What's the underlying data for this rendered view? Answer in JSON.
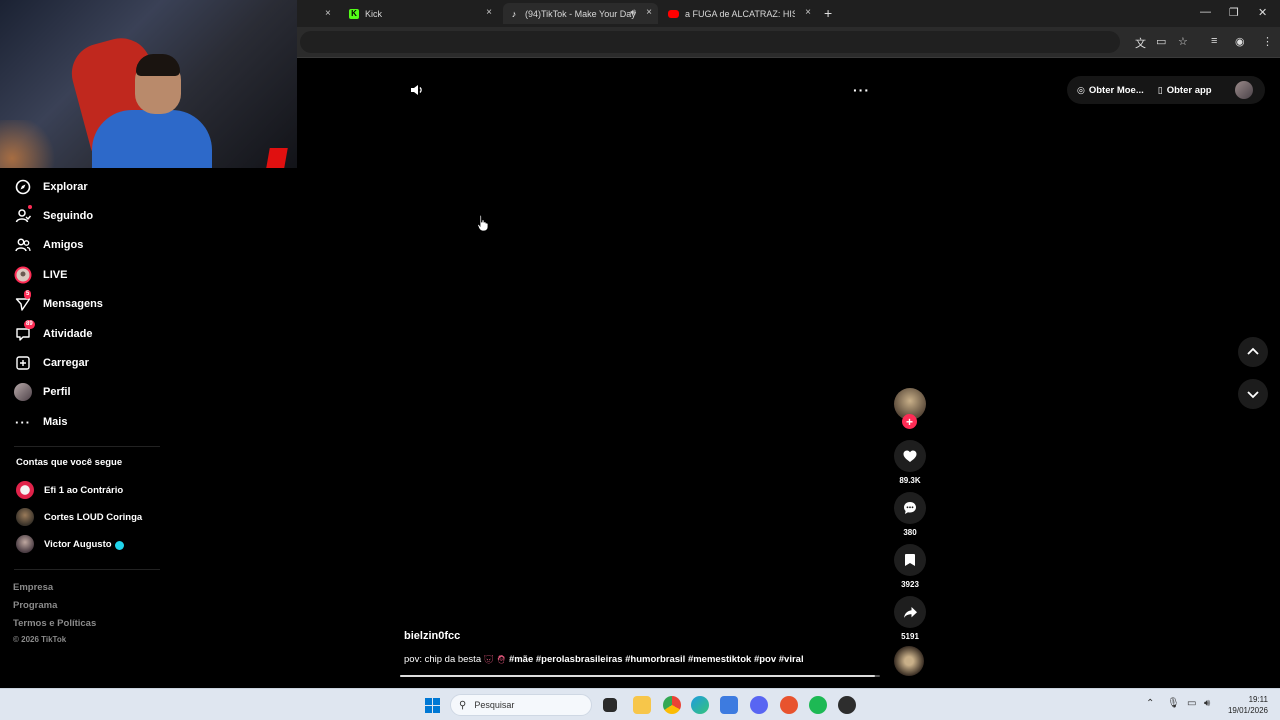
{
  "browser": {
    "tabs": [
      {
        "label": "Kick",
        "active": false
      },
      {
        "label": "(94)TikTok - Make Your Day",
        "active": true
      },
      {
        "label": "a FUGA de ALCATRAZ: HISTÓRI",
        "active": false
      }
    ],
    "add_tab": "+"
  },
  "sidebar": {
    "nav": [
      {
        "label": "Explorar",
        "icon": "compass-icon"
      },
      {
        "label": "Seguindo",
        "icon": "following-icon"
      },
      {
        "label": "Amigos",
        "icon": "friends-icon"
      },
      {
        "label": "LIVE",
        "icon": "live-icon"
      },
      {
        "label": "Mensagens",
        "icon": "messages-icon",
        "badge": "5"
      },
      {
        "label": "Atividade",
        "icon": "activity-icon",
        "badge": "89"
      },
      {
        "label": "Carregar",
        "icon": "upload-icon"
      },
      {
        "label": "Perfil",
        "icon": "profile-icon"
      },
      {
        "label": "Mais",
        "icon": "more-icon"
      }
    ],
    "following_title": "Contas que você segue",
    "following": [
      {
        "name": "Efi 1 ao Contrário"
      },
      {
        "name": "Cortes LOUD Coringa"
      },
      {
        "name": "Victor Augusto"
      }
    ],
    "footer": [
      "Empresa",
      "Programa",
      "Termos e Políticas"
    ],
    "copyright": "© 2026 TikTok"
  },
  "topright": {
    "coins": "Obter Moe...",
    "app": "Obter app"
  },
  "video": {
    "author": "bielzin0fcc",
    "caption_prefix": "pov: chip da besta",
    "caption_tags": "#mãe #perolasbrasileiras #humorbrasil #memestiktok #pov #viral",
    "progress": 0.99,
    "likes": "89.3K",
    "comments": "380",
    "saves": "3923",
    "shares": "5191"
  },
  "taskbar": {
    "search_placeholder": "Pesquisar",
    "time": "19:11",
    "date": "19/01/2026"
  },
  "colors": {
    "accent": "#fe2c55",
    "verified": "#20d5ec"
  }
}
